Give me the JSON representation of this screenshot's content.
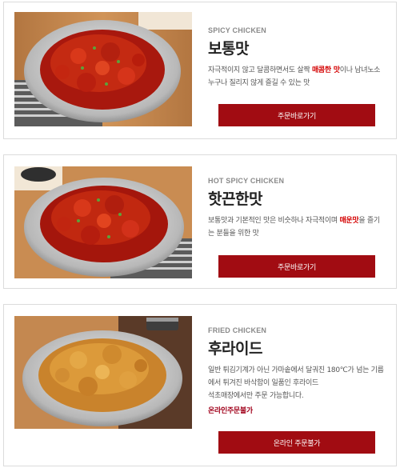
{
  "menu": [
    {
      "eng": "SPICY CHICKEN",
      "name": "보통맛",
      "desc_a": "자극적이지 않고 달콤하면서도 살짝 ",
      "desc_hl": "매콤한 맛",
      "desc_b": "이나 남녀노소 누구나 질리지 않게 즐길 수 있는 맛",
      "button": "주문바로가기",
      "icon": "spicy-chicken-photo"
    },
    {
      "eng": "HOT SPICY CHICKEN",
      "name": "핫끈한맛",
      "desc_a": "보통맛과 기본적인 맛은 비슷하나 자극적이며 ",
      "desc_hl": "매운맛",
      "desc_b": "을 즐기는 분들을 위한 맛",
      "button": "주문바로가기",
      "icon": "hot-spicy-chicken-photo"
    },
    {
      "eng": "FRIED CHICKEN",
      "name": "후라이드",
      "desc_a": "일반 튀김기계가 아닌 가마솥에서 달궈진 180℃가 넘는 기름에서 튀겨진 바삭함이 일품인 후라이드",
      "desc_c": "석초매장에서만 주문 가능합니다.",
      "note": "온라인주문불가",
      "button": "온라인 주문불가",
      "icon": "fried-chicken-photo"
    }
  ],
  "colors": {
    "button": "#a10c12",
    "highlight": "#d40000",
    "border": "#dcdcdc"
  }
}
